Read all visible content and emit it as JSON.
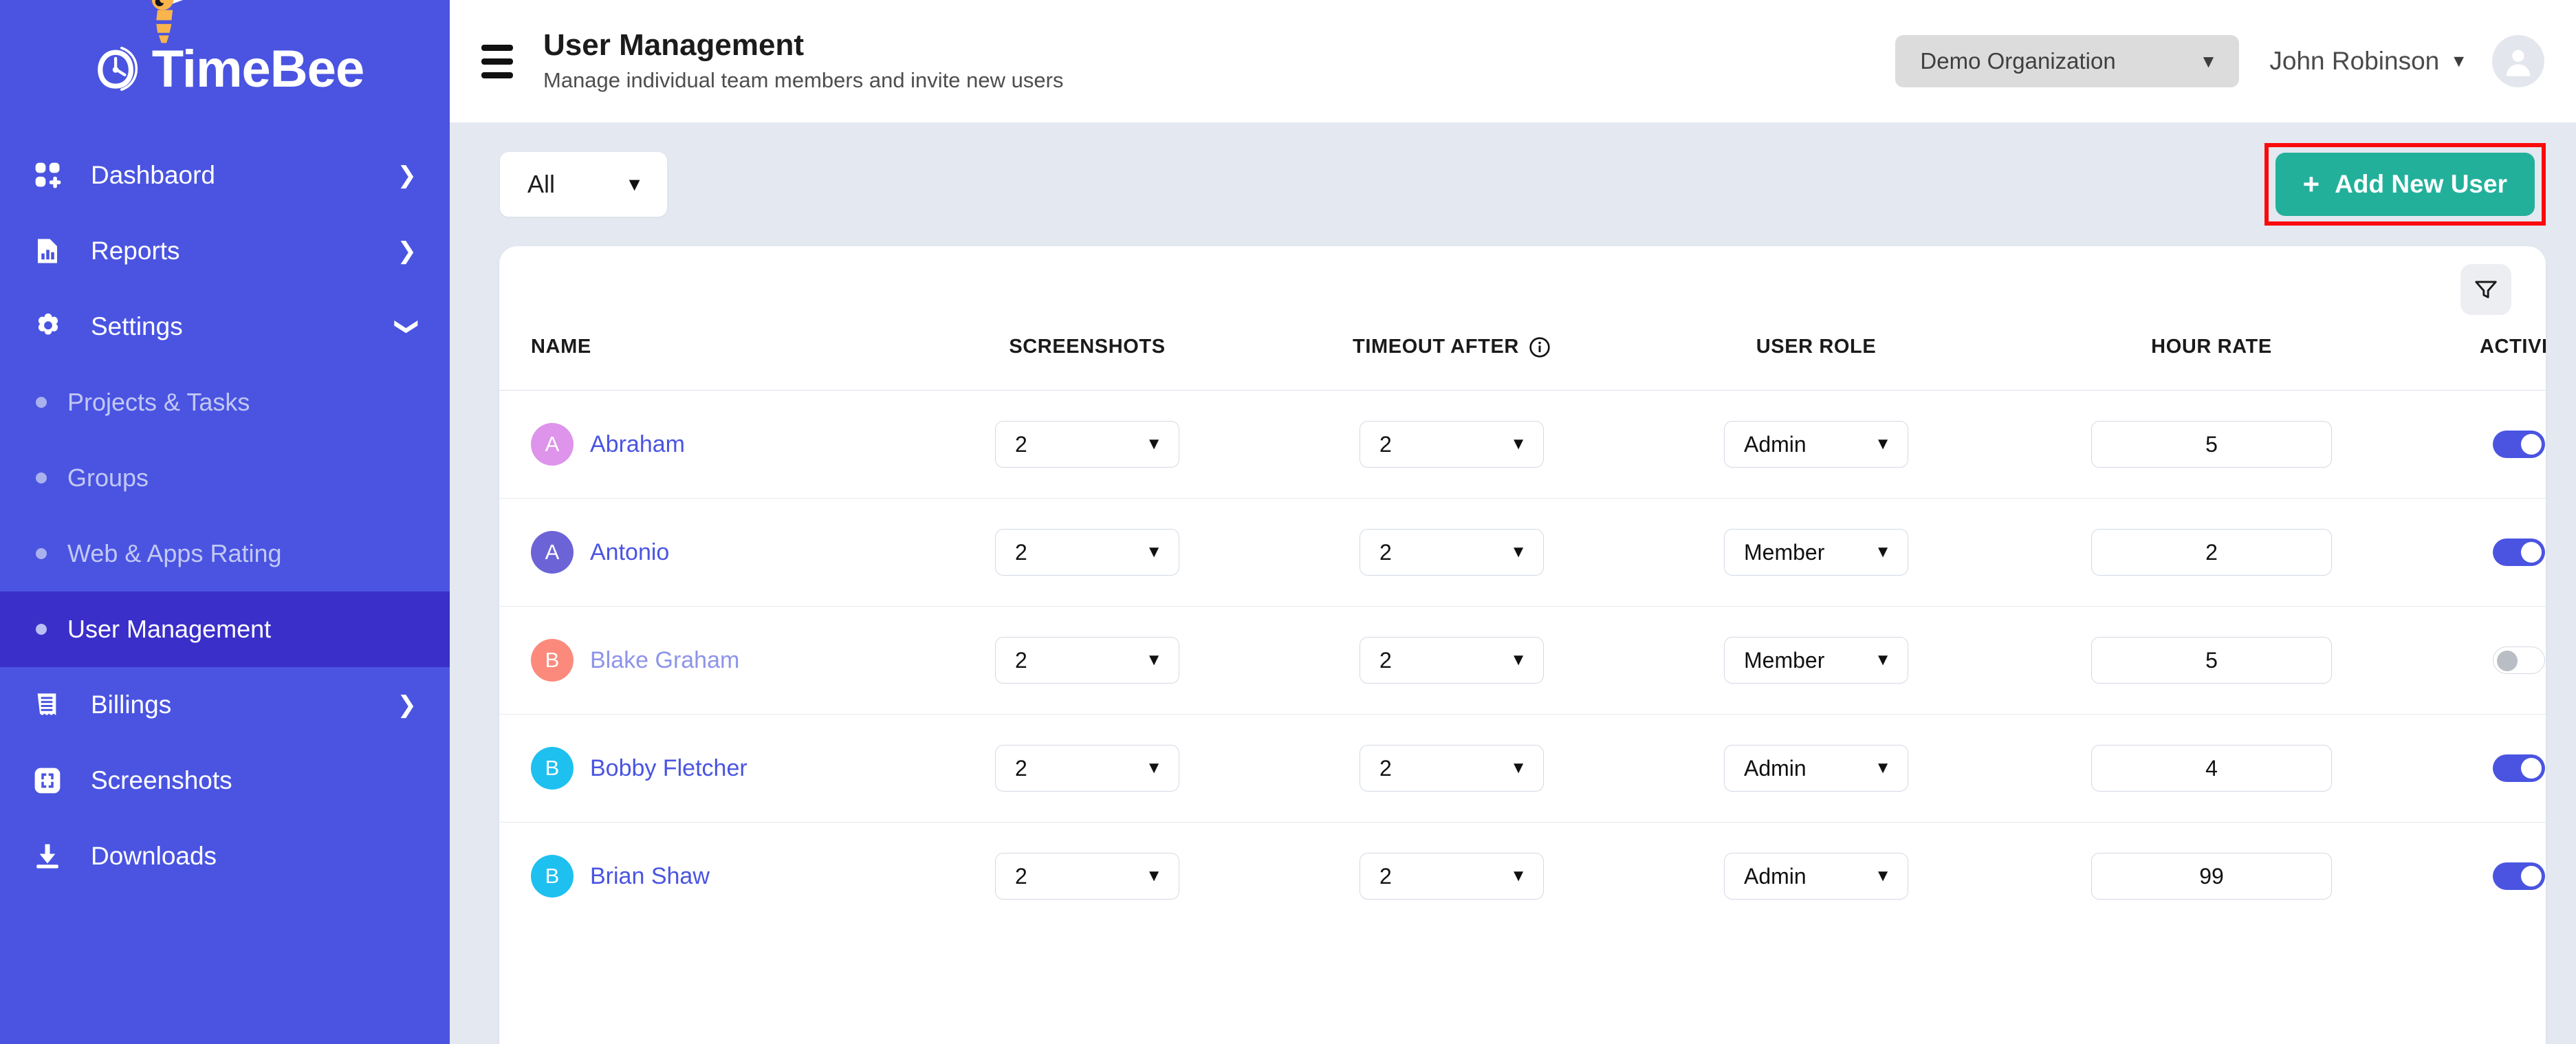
{
  "brand": {
    "name": "TimeBee",
    "logo_icon": "clock-icon",
    "bee_icon": "bee-icon",
    "sidebar_color": "#4a54e1",
    "active_item_color": "#3b2fc9"
  },
  "sidebar": {
    "items": [
      {
        "label": "Dashbaord",
        "icon": "grid-dashboard-icon",
        "chevron": "❯",
        "type": "parent"
      },
      {
        "label": "Reports",
        "icon": "report-chart-icon",
        "chevron": "❯",
        "type": "parent"
      },
      {
        "label": "Settings",
        "icon": "gear-icon",
        "chevron": "❯",
        "type": "parent-expanded"
      }
    ],
    "settings_children": [
      {
        "label": "Projects & Tasks",
        "active": false
      },
      {
        "label": "Groups",
        "active": false
      },
      {
        "label": "Web & Apps Rating",
        "active": false
      },
      {
        "label": "User Management",
        "active": true
      }
    ],
    "items_bottom": [
      {
        "label": "Billings",
        "icon": "receipt-icon",
        "chevron": "❯",
        "type": "parent"
      },
      {
        "label": "Screenshots",
        "icon": "screenshot-frame-icon",
        "chevron": "",
        "type": "leaf"
      },
      {
        "label": "Downloads",
        "icon": "download-icon",
        "chevron": "",
        "type": "leaf"
      }
    ]
  },
  "header": {
    "menu_icon": "hamburger-menu-icon",
    "title": "User Management",
    "subtitle": "Manage individual team members and invite new users",
    "organization": {
      "value": "Demo Organization",
      "caret": "▼"
    },
    "user": {
      "name": "John Robinson",
      "caret": "▼",
      "avatar_icon": "user-avatar-icon"
    }
  },
  "toolbar": {
    "filter_select": {
      "value": "All",
      "caret": "▼"
    },
    "add_user_button": {
      "label": "Add New User",
      "plus": "+",
      "color": "#22b09b",
      "highlight_color": "#fb0b0b"
    }
  },
  "table": {
    "filter_icon": "funnel-filter-icon",
    "columns": [
      {
        "key": "name",
        "label": "NAME"
      },
      {
        "key": "screenshots",
        "label": "SCREENSHOTS"
      },
      {
        "key": "timeout",
        "label": "TIMEOUT AFTER",
        "info_icon": "info-circle-icon"
      },
      {
        "key": "role",
        "label": "USER ROLE"
      },
      {
        "key": "rate",
        "label": "HOUR RATE"
      },
      {
        "key": "active",
        "label": "ACTIVE"
      }
    ],
    "caret": "▼",
    "rows": [
      {
        "initial": "A",
        "avatar_color": "#dd94ea",
        "name": "Abraham",
        "screenshots": "2",
        "timeout": "2",
        "role": "Admin",
        "rate": "5",
        "active": true
      },
      {
        "initial": "A",
        "avatar_color": "#6c63d6",
        "name": "Antonio",
        "screenshots": "2",
        "timeout": "2",
        "role": "Member",
        "rate": "2",
        "active": true
      },
      {
        "initial": "B",
        "avatar_color": "#fb8a7d",
        "name": "Blake Graham",
        "screenshots": "2",
        "timeout": "2",
        "role": "Member",
        "rate": "5",
        "active": false
      },
      {
        "initial": "B",
        "avatar_color": "#1ec0ef",
        "name": "Bobby Fletcher",
        "screenshots": "2",
        "timeout": "2",
        "role": "Admin",
        "rate": "4",
        "active": true
      },
      {
        "initial": "B",
        "avatar_color": "#1ec0ef",
        "name": "Brian Shaw",
        "screenshots": "2",
        "timeout": "2",
        "role": "Admin",
        "rate": "99",
        "active": true
      }
    ]
  }
}
